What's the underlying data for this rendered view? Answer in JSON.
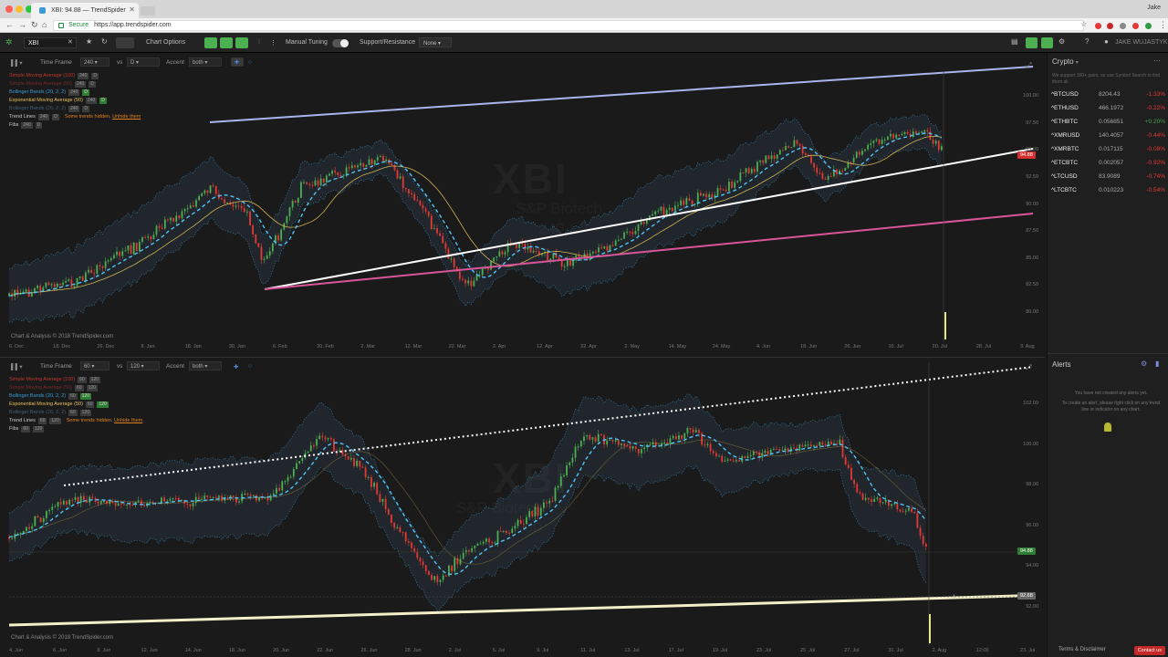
{
  "browser": {
    "tab_title": "XBI: 94.88 — TrendSpider",
    "user": "Jake",
    "secure_label": "Secure",
    "url": "https://app.trendspider.com"
  },
  "toolbar": {
    "symbol": "XBI",
    "chart_options": "Chart Options",
    "manual_tuning": "Manual Tuning",
    "support_resistance": "Support/Resistance",
    "sr_value": "None",
    "user_name": "JAKE WUJASTYK"
  },
  "panel1": {
    "time_frame_label": "Time Frame",
    "time_frame": "240",
    "vs_label": "vs",
    "vs_value": "D",
    "accent_label": "Accent",
    "accent_value": "both",
    "legend": [
      {
        "name": "Simple Moving Average (100)",
        "badges": [
          "240",
          "D"
        ],
        "color": "#c0392b"
      },
      {
        "name": "Simple Moving Average (50)",
        "badges": [
          "240",
          "D"
        ],
        "color": "#7a2b2b"
      },
      {
        "name": "Bollinger Bands (20, 2, 2)",
        "badges": [
          "240",
          "D"
        ],
        "color": "#3a9bd5"
      },
      {
        "name": "Exponential Moving Average (50)",
        "badges": [
          "240",
          "D"
        ],
        "color": "#e6c25a"
      },
      {
        "name": "Bollinger Bands (20, 2, 2)",
        "badges": [
          "240",
          "D"
        ],
        "color": "#3e5f77"
      },
      {
        "name": "Trend Lines",
        "badges": [
          "240",
          "D"
        ],
        "color": "#ccc"
      },
      {
        "name": "Fibs",
        "badges": [
          "240",
          "D"
        ],
        "color": "#ccc"
      }
    ],
    "hidden_note": "Some trends hidden.",
    "unhide": "Unhide them",
    "watermark": "XBI",
    "watermark_sub": "S&P Biotech",
    "watermark_tf": "240",
    "copyright": "Chart & Analysis © 2018 TrendSpider.com",
    "x_labels": [
      "6. Dec",
      "18. Dec",
      "26. Dec",
      "8. Jan",
      "18. Jan",
      "30. Jan",
      "6. Feb",
      "20. Feb",
      "2. Mar",
      "12. Mar",
      "22. Mar",
      "2. Apr",
      "12. Apr",
      "22. Apr",
      "2. May",
      "14. May",
      "24. May",
      "4. Jun",
      "18. Jun",
      "26. Jun",
      "10. Jul",
      "20. Jul",
      "28. Jul",
      "3. Aug"
    ],
    "y_labels": [
      "100.00",
      "97.50",
      "95.00",
      "92.50",
      "90.00",
      "87.50",
      "85.00",
      "82.50",
      "80.00"
    ],
    "price_tag": "94.88"
  },
  "panel2": {
    "time_frame_label": "Time Frame",
    "time_frame": "60",
    "vs_label": "vs",
    "vs_value": "120",
    "accent_label": "Accent",
    "accent_value": "both",
    "legend": [
      {
        "name": "Simple Moving Average (100)",
        "badges": [
          "60",
          "120"
        ],
        "color": "#c0392b"
      },
      {
        "name": "Simple Moving Average (50)",
        "badges": [
          "60",
          "120"
        ],
        "color": "#7a2b2b"
      },
      {
        "name": "Bollinger Bands (20, 2, 2)",
        "badges": [
          "60",
          "120"
        ],
        "color": "#3a9bd5"
      },
      {
        "name": "Exponential Moving Average (50)",
        "badges": [
          "60",
          "120"
        ],
        "color": "#e6c25a"
      },
      {
        "name": "Bollinger Bands (20, 2, 2)",
        "badges": [
          "60",
          "120"
        ],
        "color": "#3e5f77"
      },
      {
        "name": "Trend Lines",
        "badges": [
          "60",
          "120"
        ],
        "color": "#ccc"
      },
      {
        "name": "Fibs",
        "badges": [
          "60",
          "120"
        ],
        "color": "#ccc"
      }
    ],
    "hidden_note": "Some trends hidden.",
    "unhide": "Unhide them",
    "watermark": "XBI",
    "watermark_sub": "S&P Biotech",
    "watermark_tf": "60",
    "copyright": "Chart & Analysis © 2018 TrendSpider.com",
    "x_labels": [
      "4. Jun",
      "6. Jun",
      "8. Jun",
      "12. Jun",
      "14. Jun",
      "18. Jun",
      "20. Jun",
      "22. Jun",
      "26. Jun",
      "28. Jun",
      "2. Jul",
      "5. Jul",
      "9. Jul",
      "11. Jul",
      "13. Jul",
      "17. Jul",
      "19. Jul",
      "23. Jul",
      "25. Jul",
      "27. Jul",
      "31. Jul",
      "2. Aug",
      "12:00",
      "23. Jul"
    ],
    "y_labels": [
      "102.00",
      "100.00",
      "98.00",
      "96.00",
      "94.00",
      "92.00"
    ],
    "price_tag": "94.88",
    "line_tag": "92.68"
  },
  "sidebar": {
    "crypto_title": "Crypto",
    "crypto_note": "We support 300+ pairs, so use Symbol Search to find them all",
    "rows": [
      {
        "sym": "^BTCUSD",
        "val": "8204.43",
        "chg": "-1.33%",
        "color": "#e53935"
      },
      {
        "sym": "^ETHUSD",
        "val": "466.1972",
        "chg": "-0.22%",
        "color": "#e53935"
      },
      {
        "sym": "^ETHBTC",
        "val": "0.056851",
        "chg": "+0.20%",
        "color": "#43a047"
      },
      {
        "sym": "^XMRUSD",
        "val": "140.4057",
        "chg": "-0.44%",
        "color": "#e53935"
      },
      {
        "sym": "^XMRBTC",
        "val": "0.017115",
        "chg": "-0.08%",
        "color": "#e53935"
      },
      {
        "sym": "^ETCBTC",
        "val": "0.002057",
        "chg": "-0.92%",
        "color": "#e53935"
      },
      {
        "sym": "^LTCUSD",
        "val": "83.9089",
        "chg": "-0.74%",
        "color": "#e53935"
      },
      {
        "sym": "^LTCBTC",
        "val": "0.010223",
        "chg": "-0.54%",
        "color": "#e53935"
      }
    ],
    "alerts_title": "Alerts",
    "alerts_msg1": "You have not created any alerts yet.",
    "alerts_msg2": "To create an alert, please right click on any trend line or indicator on any chart.",
    "terms": "Terms & Disclaimer",
    "contact": "Contact us"
  },
  "colors": {
    "bull": "#4caf50",
    "bear": "#e53935",
    "bband": "#3a9bd5",
    "ema": "#e6c25a"
  }
}
